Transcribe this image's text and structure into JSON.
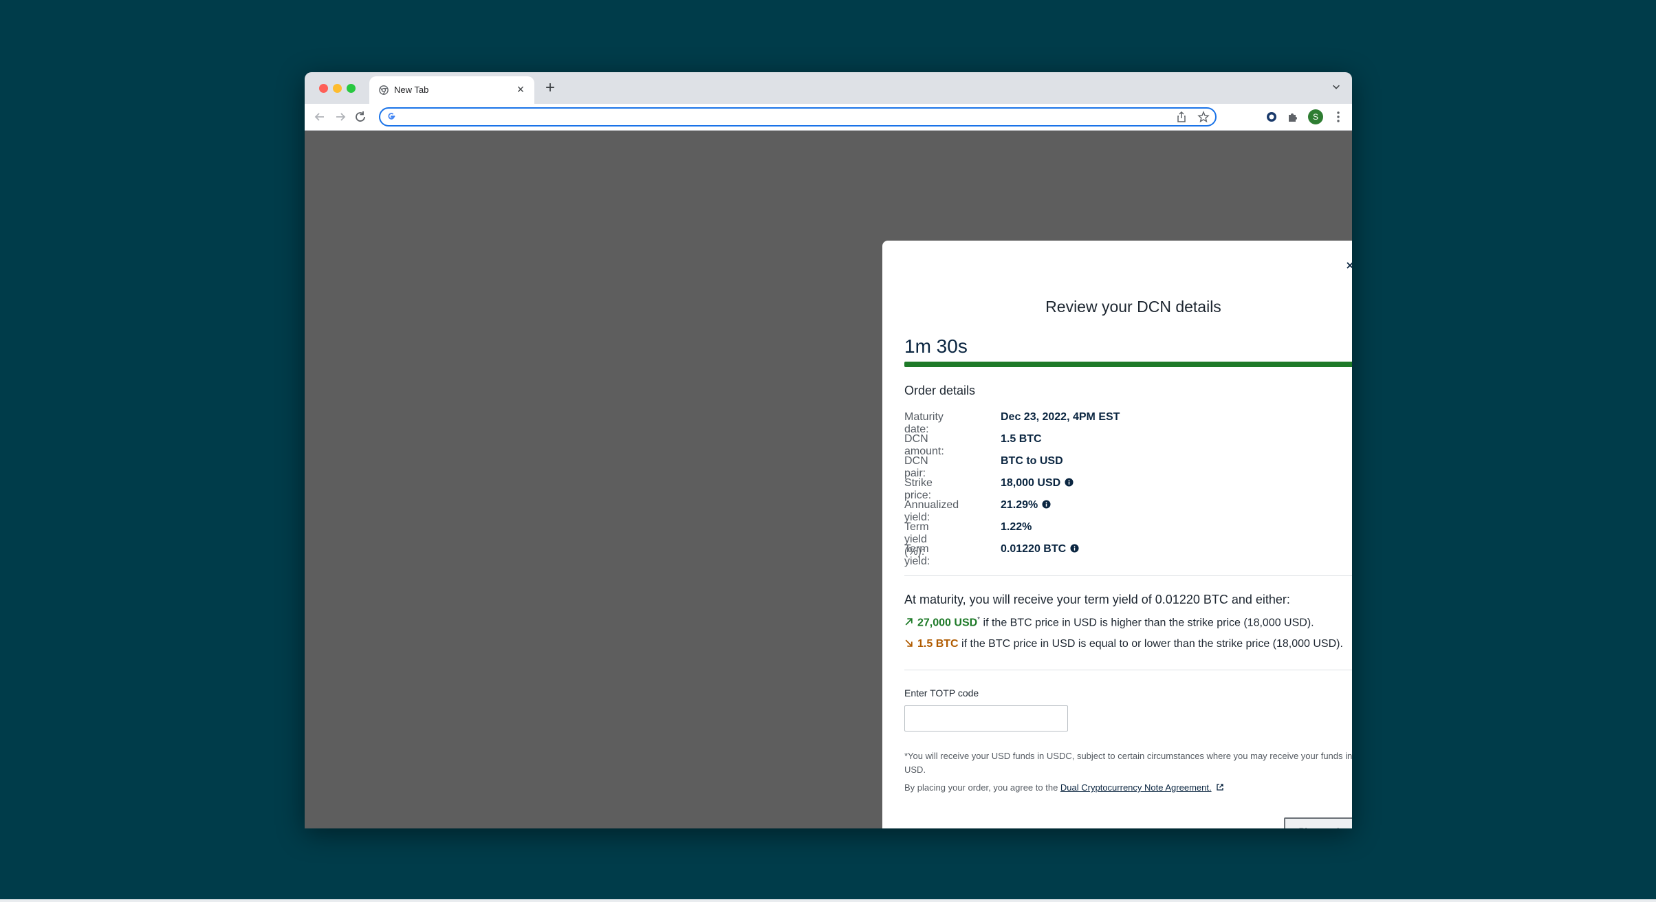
{
  "browser": {
    "tab_title": "New Tab",
    "omnibox_value": "",
    "profile_initial": "S"
  },
  "modal": {
    "title": "Review your DCN details",
    "countdown": "1m 30s",
    "countdown_progress": 1.0,
    "order_details_title": "Order details",
    "details": [
      {
        "label": "Maturity date:",
        "value": "Dec 23, 2022, 4PM EST",
        "info": false
      },
      {
        "label": "DCN amount:",
        "value": "1.5 BTC",
        "info": false
      },
      {
        "label": "DCN pair:",
        "value": "BTC to USD",
        "info": false
      },
      {
        "label": "Strike price:",
        "value": "18,000 USD",
        "info": true
      },
      {
        "label": "Annualized yield:",
        "value": "21.29%",
        "info": true
      },
      {
        "label": "Term yield (%):",
        "value": "1.22%",
        "info": false
      },
      {
        "label": "Term yield:",
        "value": "0.01220 BTC",
        "info": true
      }
    ],
    "maturity_title": "At maturity, you will receive your term yield of 0.01220 BTC and either:",
    "outcome_up": {
      "amount": "27,000 USD",
      "mark": "*",
      "text": " if the BTC price in USD is higher than the strike price (18,000 USD)."
    },
    "outcome_down": {
      "amount": "1.5 BTC",
      "text": " if the BTC price in USD is equal to or lower than the strike price (18,000 USD)."
    },
    "totp_label": "Enter TOTP code",
    "totp_value": "",
    "footnote": "*You will receive your USD funds in USDC, subject to certain circumstances where you may receive your funds in USD.",
    "agree_prefix": "By placing your order, you agree to the ",
    "agree_link": "Dual Cryptocurrency Note Agreement.",
    "place_order_label": "Place order"
  },
  "colors": {
    "page_bg": "#003c4a",
    "progress": "#1e7a28",
    "up": "#1e7a28",
    "down": "#b05b00",
    "navy": "#0a2540"
  }
}
